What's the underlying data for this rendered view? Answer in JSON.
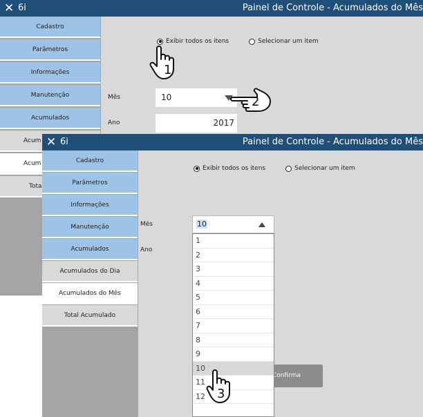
{
  "window": {
    "close_glyph": "✕",
    "app_name": "6i",
    "title": "Painel de Controle - Acumulados do Mês"
  },
  "nav": [
    "Cadastro",
    "Parâmetros",
    "Informações",
    "Manutenção",
    "Acumulados",
    "Acumulados do Dia",
    "Acumulados do Mês",
    "Total Acumulado"
  ],
  "nav_partial": [
    "Acum",
    "Acum",
    "Tota"
  ],
  "radios": {
    "all": "Exibir todos os itens",
    "select": "Selecionar um item"
  },
  "fields": {
    "month_label": "Mês",
    "year_label": "Ano",
    "month_value": "10",
    "year_value": "2017"
  },
  "dropdown": {
    "options": [
      "1",
      "2",
      "3",
      "4",
      "5",
      "6",
      "7",
      "8",
      "9",
      "10",
      "11",
      "12"
    ],
    "selected_value": "10"
  },
  "confirm_label": "Confirma",
  "steps": [
    "1",
    "2",
    "3"
  ],
  "icons": {
    "hand": "hand-pointer-icon",
    "arrow": "triangle-arrow-icon"
  },
  "colors": {
    "titlebar": "#1f4e79",
    "nav_blue": "#9dc3e6",
    "nav_gray": "#d9d9d9",
    "content": "#d9d9d9",
    "sidebar": "#a5a5a5"
  }
}
